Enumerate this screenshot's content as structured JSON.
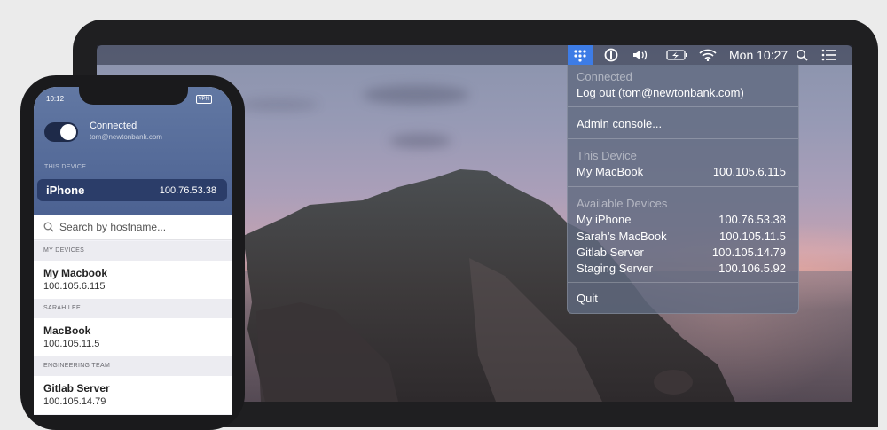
{
  "menubar": {
    "clock": "Mon 10:27",
    "icons": [
      "tailscale-icon",
      "password-manager-icon",
      "volume-icon",
      "battery-icon",
      "wifi-icon",
      "search-icon",
      "control-center-icon"
    ]
  },
  "menu": {
    "connected_header": "Connected",
    "logout": "Log out (tom@newtonbank.com)",
    "admin": "Admin console...",
    "this_device_header": "This Device",
    "this_device": {
      "name": "My MacBook",
      "ip": "100.105.6.115"
    },
    "available_header": "Available Devices",
    "available": [
      {
        "name": "My iPhone",
        "ip": "100.76.53.38"
      },
      {
        "name": "Sarah’s MacBook",
        "ip": "100.105.11.5"
      },
      {
        "name": "Gitlab Server",
        "ip": "100.105.14.79"
      },
      {
        "name": "Staging Server",
        "ip": "100.106.5.92"
      }
    ],
    "quit": "Quit"
  },
  "phone": {
    "time": "10:12",
    "vpn": "VPN",
    "status": "Connected",
    "email": "tom@newtonbank.com",
    "this_device_label": "THIS DEVICE",
    "this_device": {
      "name": "iPhone",
      "ip": "100.76.53.38"
    },
    "search_placeholder": "Search by hostname...",
    "sections": [
      {
        "label": "MY DEVICES",
        "items": [
          {
            "name": "My Macbook",
            "ip": "100.105.6.115"
          }
        ]
      },
      {
        "label": "SARAH LEE",
        "items": [
          {
            "name": "MacBook",
            "ip": "100.105.11.5"
          }
        ]
      },
      {
        "label": "ENGINEERING TEAM",
        "items": [
          {
            "name": "Gitlab Server",
            "ip": "100.105.14.79"
          }
        ]
      }
    ]
  }
}
